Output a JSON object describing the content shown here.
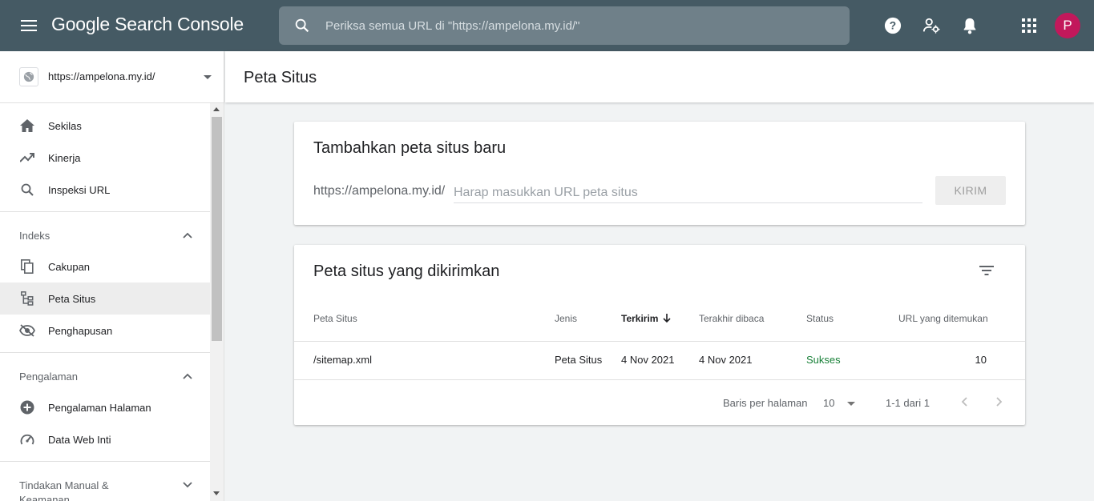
{
  "app": {
    "title": "Google Search Console",
    "search_placeholder": "Periksa semua URL di \"https://ampelona.my.id/\"",
    "avatar_letter": "P",
    "avatar_color": "#c2185b",
    "topbar_color": "#455a64"
  },
  "sidebar": {
    "property_url": "https://ampelona.my.id/",
    "items": [
      {
        "label": "Sekilas",
        "icon": "home-icon"
      },
      {
        "label": "Kinerja",
        "icon": "trending-up-icon"
      },
      {
        "label": "Inspeksi URL",
        "icon": "search-icon"
      }
    ],
    "sections": [
      {
        "label": "Indeks",
        "expanded": true,
        "items": [
          {
            "label": "Cakupan",
            "icon": "copy-icon"
          },
          {
            "label": "Peta Situs",
            "icon": "sitemap-icon",
            "active": true
          },
          {
            "label": "Penghapusan",
            "icon": "eye-off-icon"
          }
        ]
      },
      {
        "label": "Pengalaman",
        "expanded": true,
        "items": [
          {
            "label": "Pengalaman Halaman",
            "icon": "add-circle-icon"
          },
          {
            "label": "Data Web Inti",
            "icon": "speed-gauge-icon"
          }
        ]
      },
      {
        "label": "Tindakan Manual & Keamanan",
        "expanded": false
      }
    ]
  },
  "page": {
    "title": "Peta Situs"
  },
  "add_card": {
    "title": "Tambahkan peta situs baru",
    "prefix": "https://ampelona.my.id/",
    "placeholder": "Harap masukkan URL peta situs",
    "submit_label": "KIRIM"
  },
  "submitted_card": {
    "title": "Peta situs yang dikirimkan",
    "columns": [
      "Peta Situs",
      "Jenis",
      "Terkirim",
      "Terakhir dibaca",
      "Status",
      "URL yang ditemukan"
    ],
    "rows": [
      [
        "/sitemap.xml",
        "Peta Situs",
        "4 Nov 2021",
        "4 Nov 2021",
        "Sukses",
        "10"
      ]
    ],
    "rows_per_page_label": "Baris per halaman",
    "rows_per_page_value": "10",
    "range_label": "1-1 dari 1",
    "status_success_color": "#188038"
  }
}
